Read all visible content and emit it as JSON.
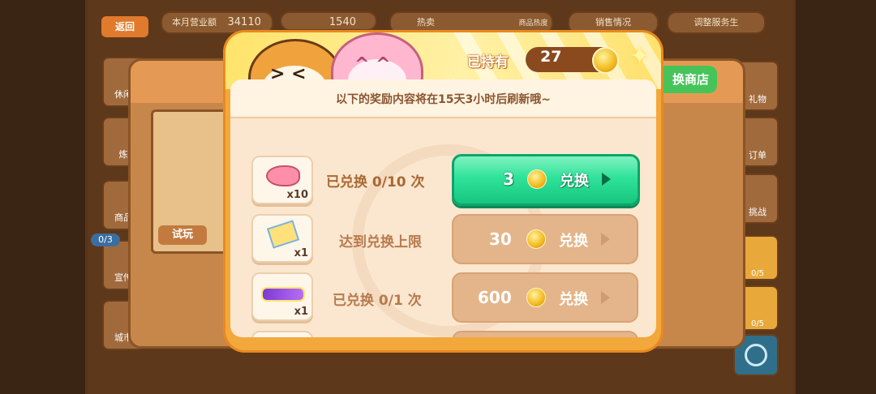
{
  "background": {
    "back_label": "返回",
    "revenue_label": "本月营业额",
    "revenue_value": "34110",
    "fish_value": "1540",
    "heat_label": "热卖",
    "product_heat_label": "商品热度",
    "sales_label": "销售情况",
    "staff_label": "调整服务生",
    "shop_label": "换商店",
    "trial_label": "试玩",
    "left_buttons": [
      "休闲",
      "炼",
      "商品",
      "宣传",
      "城市"
    ],
    "right_buttons": [
      "礼物",
      "订单",
      "挑战"
    ],
    "progress_left": "0/3",
    "progress_right_1": "0/5",
    "progress_right_2": "0/5"
  },
  "header": {
    "held_label": "已持有",
    "held_value": "27"
  },
  "notice": "以下的奖励内容将在15天3小时后刷新哦~",
  "rewards": [
    {
      "icon": "fish-icon",
      "qty": "x10",
      "status": "已兑换  0/10  次",
      "price": "3",
      "button": "兑换",
      "enabled": true
    },
    {
      "icon": "ticket-icon",
      "qty": "x1",
      "status": "达到兑换上限",
      "price": "30",
      "button": "兑换",
      "enabled": false
    },
    {
      "icon": "nameplate-icon",
      "qty": "x1",
      "status": "已兑换  0/1  次",
      "price": "600",
      "button": "兑换",
      "enabled": false
    }
  ],
  "colors": {
    "modal_orange": "#f3a83c",
    "button_green": "#2fe29a",
    "button_disabled": "#e4b58a"
  }
}
